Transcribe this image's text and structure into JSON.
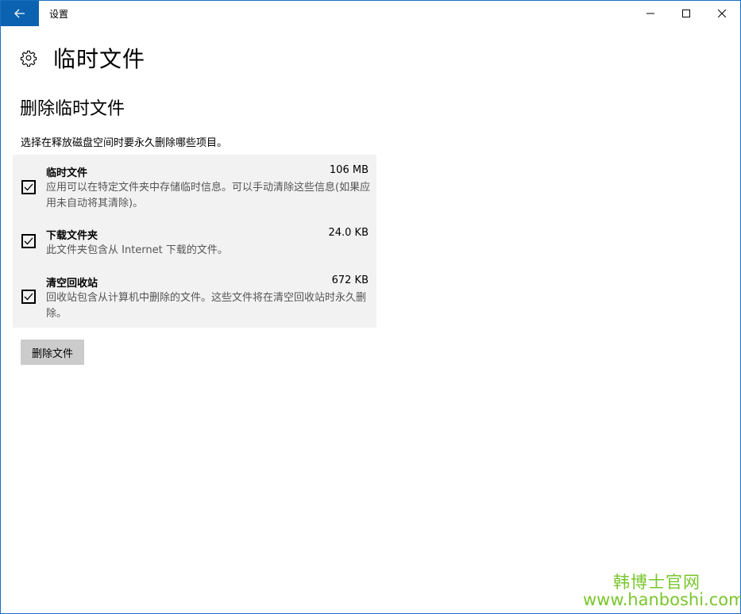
{
  "window": {
    "title": "设置"
  },
  "page": {
    "title": "临时文件"
  },
  "section": {
    "title": "删除临时文件",
    "description": "选择在释放磁盘空间时要永久删除哪些项目。"
  },
  "items": [
    {
      "name": "临时文件",
      "size": "106 MB",
      "description": "应用可以在特定文件夹中存储临时信息。可以手动清除这些信息(如果应用未自动将其清除)。",
      "checked": true
    },
    {
      "name": "下载文件夹",
      "size": "24.0 KB",
      "description": "此文件夹包含从 Internet 下载的文件。",
      "checked": true
    },
    {
      "name": "清空回收站",
      "size": "672 KB",
      "description": "回收站包含从计算机中删除的文件。这些文件将在清空回收站时永久删除。",
      "checked": true
    }
  ],
  "actions": {
    "delete_label": "删除文件"
  },
  "watermark": {
    "name": "韩博士官网",
    "url": "www.hanboshi.com"
  },
  "colors": {
    "accent": "#0b62b0",
    "list_bg": "#f2f2f2",
    "button_bg": "#cccccc",
    "watermark": "#7ac62c"
  }
}
